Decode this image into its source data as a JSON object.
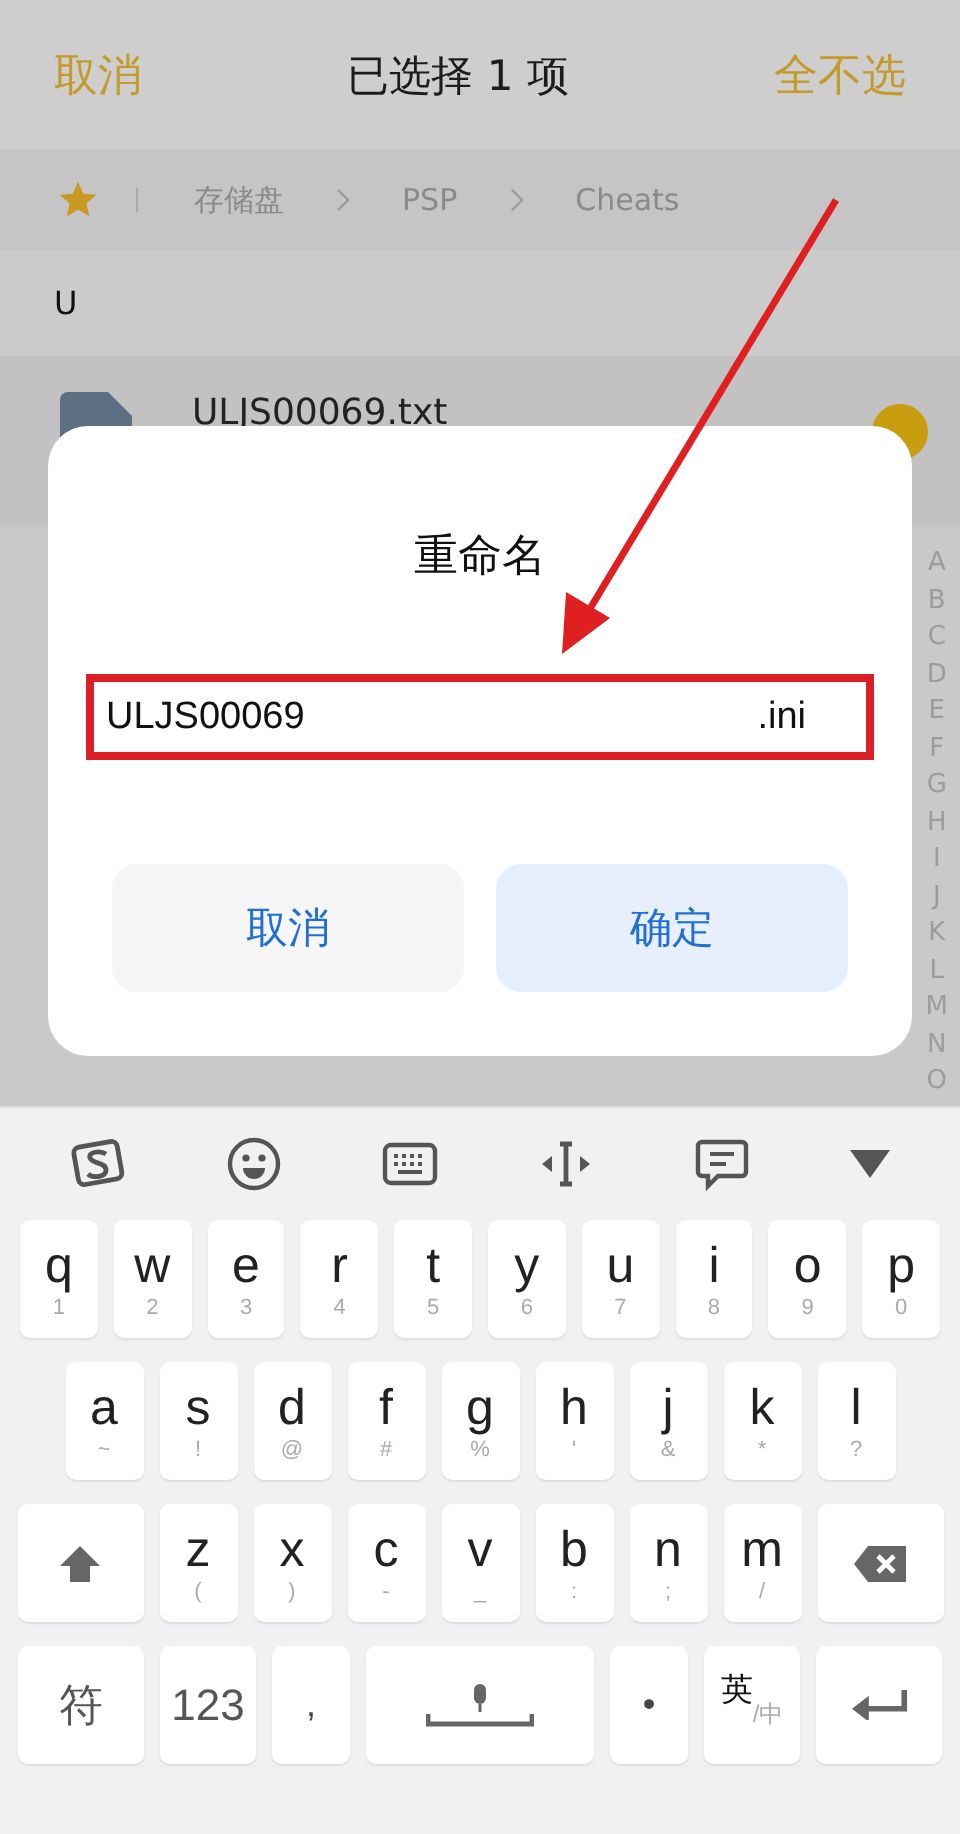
{
  "header": {
    "cancel": "取消",
    "title": "已选择 1 项",
    "deselect_all": "全不选"
  },
  "breadcrumb": [
    "存储盘",
    "PSP",
    "Cheats"
  ],
  "section_letter": "U",
  "file": {
    "name": "ULJS00069.txt",
    "selected": true
  },
  "index_letters": [
    "A",
    "B",
    "C",
    "D",
    "E",
    "F",
    "G",
    "H",
    "I",
    "J",
    "K",
    "L",
    "M",
    "N",
    "O"
  ],
  "dialog": {
    "title": "重命名",
    "name_value": "ULJS00069",
    "extension": ".ini",
    "buttons": [
      {
        "label": "取消",
        "primary": false
      },
      {
        "label": "确定",
        "primary": true
      }
    ]
  },
  "keyboard": {
    "rows": [
      {
        "keys": [
          {
            "kind": "letter",
            "label": "q",
            "hint": "1"
          },
          {
            "kind": "letter",
            "label": "w",
            "hint": "2"
          },
          {
            "kind": "letter",
            "label": "e",
            "hint": "3"
          },
          {
            "kind": "letter",
            "label": "r",
            "hint": "4"
          },
          {
            "kind": "letter",
            "label": "t",
            "hint": "5"
          },
          {
            "kind": "letter",
            "label": "y",
            "hint": "6"
          },
          {
            "kind": "letter",
            "label": "u",
            "hint": "7"
          },
          {
            "kind": "letter",
            "label": "i",
            "hint": "8"
          },
          {
            "kind": "letter",
            "label": "o",
            "hint": "9"
          },
          {
            "kind": "letter",
            "label": "p",
            "hint": "0"
          }
        ]
      },
      {
        "keys": [
          {
            "kind": "letter",
            "label": "a",
            "hint": "~"
          },
          {
            "kind": "letter",
            "label": "s",
            "hint": "!"
          },
          {
            "kind": "letter",
            "label": "d",
            "hint": "@"
          },
          {
            "kind": "letter",
            "label": "f",
            "hint": "#"
          },
          {
            "kind": "letter",
            "label": "g",
            "hint": "%"
          },
          {
            "kind": "letter",
            "label": "h",
            "hint": "'"
          },
          {
            "kind": "letter",
            "label": "j",
            "hint": "&"
          },
          {
            "kind": "letter",
            "label": "k",
            "hint": "*"
          },
          {
            "kind": "letter",
            "label": "l",
            "hint": "?"
          }
        ]
      },
      {
        "keys": [
          {
            "kind": "shift"
          },
          {
            "kind": "letter",
            "label": "z",
            "hint": "("
          },
          {
            "kind": "letter",
            "label": "x",
            "hint": ")"
          },
          {
            "kind": "letter",
            "label": "c",
            "hint": "-"
          },
          {
            "kind": "letter",
            "label": "v",
            "hint": "_"
          },
          {
            "kind": "letter",
            "label": "b",
            "hint": ":"
          },
          {
            "kind": "letter",
            "label": "n",
            "hint": ";"
          },
          {
            "kind": "letter",
            "label": "m",
            "hint": "/"
          },
          {
            "kind": "backspace"
          }
        ]
      },
      {
        "keys": [
          {
            "kind": "wide",
            "label": "符"
          },
          {
            "kind": "mid",
            "label": "123"
          },
          {
            "kind": "punct",
            "label": ","
          },
          {
            "kind": "space"
          },
          {
            "kind": "punct",
            "label": "•"
          },
          {
            "kind": "lang",
            "label": "英",
            "hint": "/中"
          },
          {
            "kind": "enter"
          }
        ]
      }
    ]
  }
}
